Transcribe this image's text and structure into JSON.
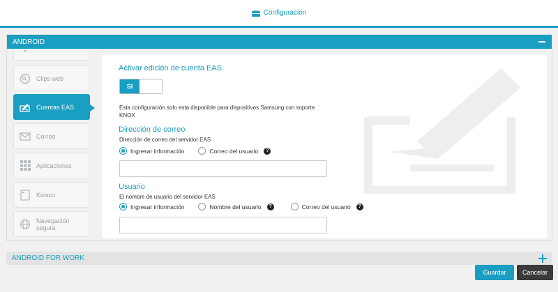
{
  "header": {
    "title": "Configuración",
    "icon": "toolbox-icon"
  },
  "panel": {
    "title": "ANDROID"
  },
  "sidebar": {
    "items": [
      {
        "label": "",
        "icon": "wifi-icon"
      },
      {
        "label": "Clips web",
        "icon": "globe-clip-icon"
      },
      {
        "label": "Cuentas EAS",
        "icon": "edit-account-icon"
      },
      {
        "label": "Correo",
        "icon": "mail-icon"
      },
      {
        "label": "Aplicaciones",
        "icon": "grid-icon"
      },
      {
        "label": "Kiosco",
        "icon": "kiosk-icon"
      },
      {
        "label": "Navegación segura",
        "icon": "globe-icon"
      }
    ]
  },
  "form": {
    "activate_title": "Activar edición de cuenta EAS",
    "toggle_label": "SI",
    "note": "Esta configuración solo esta disponible para dispositivos Samsung con soporte KNOX",
    "email_section": {
      "title": "Dirección de correo",
      "sublabel": "Dirección de correo del servidor EAS",
      "option1": "Ingresar información",
      "option2": "Correo del usuario",
      "value": ""
    },
    "user_section": {
      "title": "Usuario",
      "sublabel": "El nombre de usuario del servidor EAS",
      "option1": "Ingresar información",
      "option2": "Nombre del usuario",
      "option3": "Correo del usuario",
      "value": ""
    }
  },
  "panel2": {
    "title": "ANDROID FOR WORK"
  },
  "buttons": {
    "save": "Guardar",
    "cancel": "Cancelar"
  },
  "colors": {
    "accent": "#1a9ec1",
    "dark_button": "#3a3a3a"
  }
}
